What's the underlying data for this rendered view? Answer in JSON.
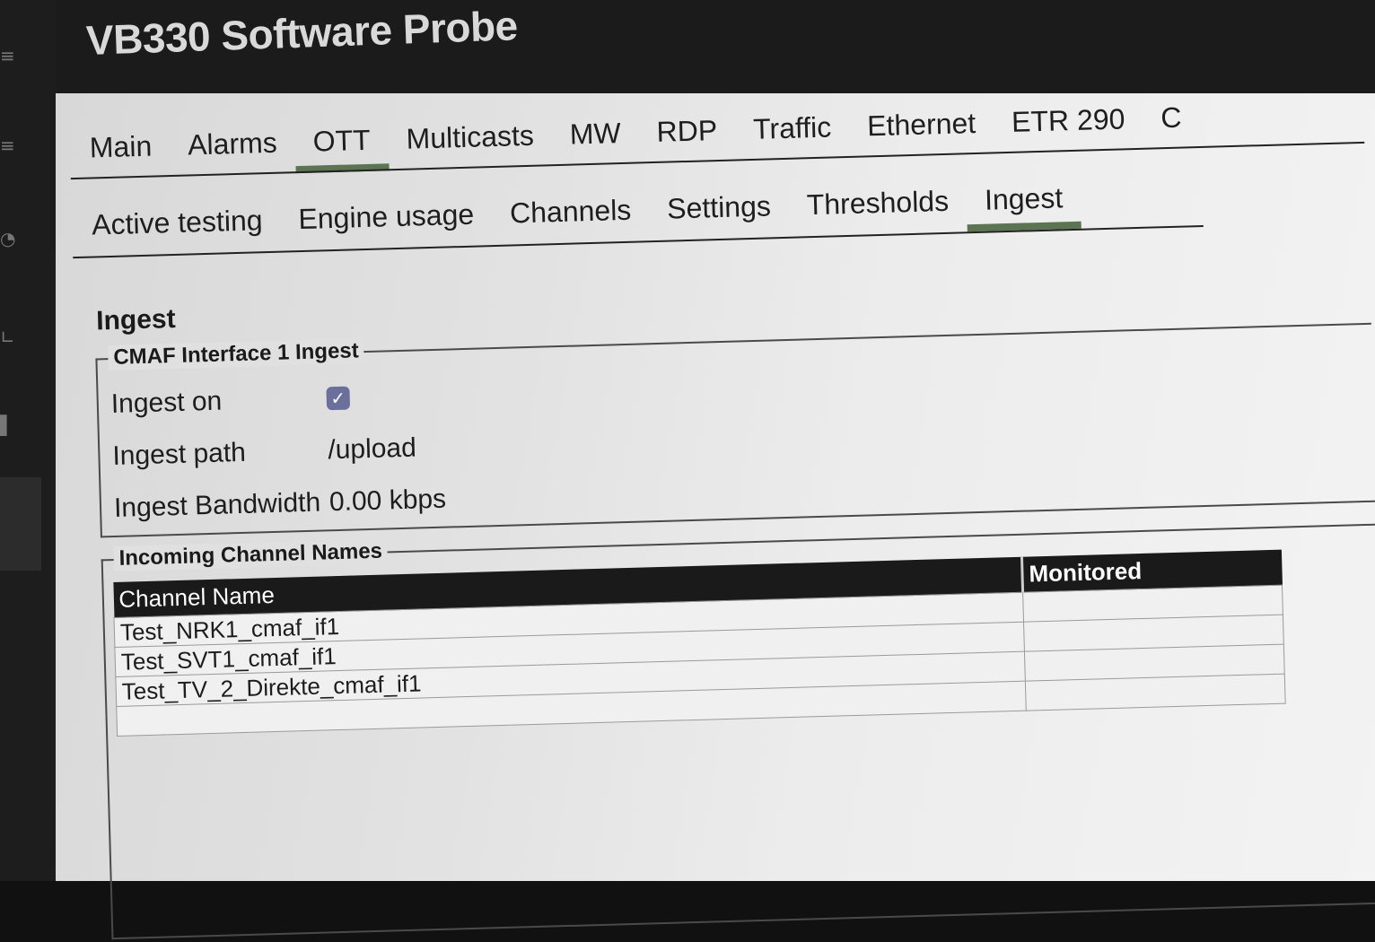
{
  "app": {
    "title": "VB330 Software Probe"
  },
  "main_tabs": [
    {
      "label": "Main",
      "active": false
    },
    {
      "label": "Alarms",
      "active": false
    },
    {
      "label": "OTT",
      "active": true
    },
    {
      "label": "Multicasts",
      "active": false
    },
    {
      "label": "MW",
      "active": false
    },
    {
      "label": "RDP",
      "active": false
    },
    {
      "label": "Traffic",
      "active": false
    },
    {
      "label": "Ethernet",
      "active": false
    },
    {
      "label": "ETR 290",
      "active": false
    },
    {
      "label": "C",
      "active": false
    }
  ],
  "sub_tabs": [
    {
      "label": "Active testing",
      "active": false
    },
    {
      "label": "Engine usage",
      "active": false
    },
    {
      "label": "Channels",
      "active": false
    },
    {
      "label": "Settings",
      "active": false
    },
    {
      "label": "Thresholds",
      "active": false
    },
    {
      "label": "Ingest",
      "active": true
    }
  ],
  "page": {
    "heading": "Ingest"
  },
  "ingest_group": {
    "legend": "CMAF Interface 1 Ingest",
    "ingest_on_label": "Ingest on",
    "ingest_on_checked": true,
    "ingest_path_label": "Ingest path",
    "ingest_path_value": "/upload",
    "bandwidth_label": "Ingest Bandwidth",
    "bandwidth_value": "0.00 kbps"
  },
  "channels_group": {
    "legend": "Incoming Channel Names",
    "columns": [
      "Channel Name",
      "Monitored"
    ],
    "rows": [
      {
        "name": "Test_NRK1_cmaf_if1",
        "monitored": ""
      },
      {
        "name": "Test_SVT1_cmaf_if1",
        "monitored": ""
      },
      {
        "name": "Test_TV_2_Direkte_cmaf_if1",
        "monitored": ""
      },
      {
        "name": "",
        "monitored": ""
      }
    ]
  },
  "icons": {
    "menu": "menu-icon",
    "list": "list-icon",
    "bell": "bell-icon",
    "chart": "chart-icon",
    "check": "check-icon"
  },
  "colors": {
    "active_tab_underline": "#5b7552",
    "checkbox": "#6b6f9c",
    "table_header": "#1a1a1a"
  }
}
